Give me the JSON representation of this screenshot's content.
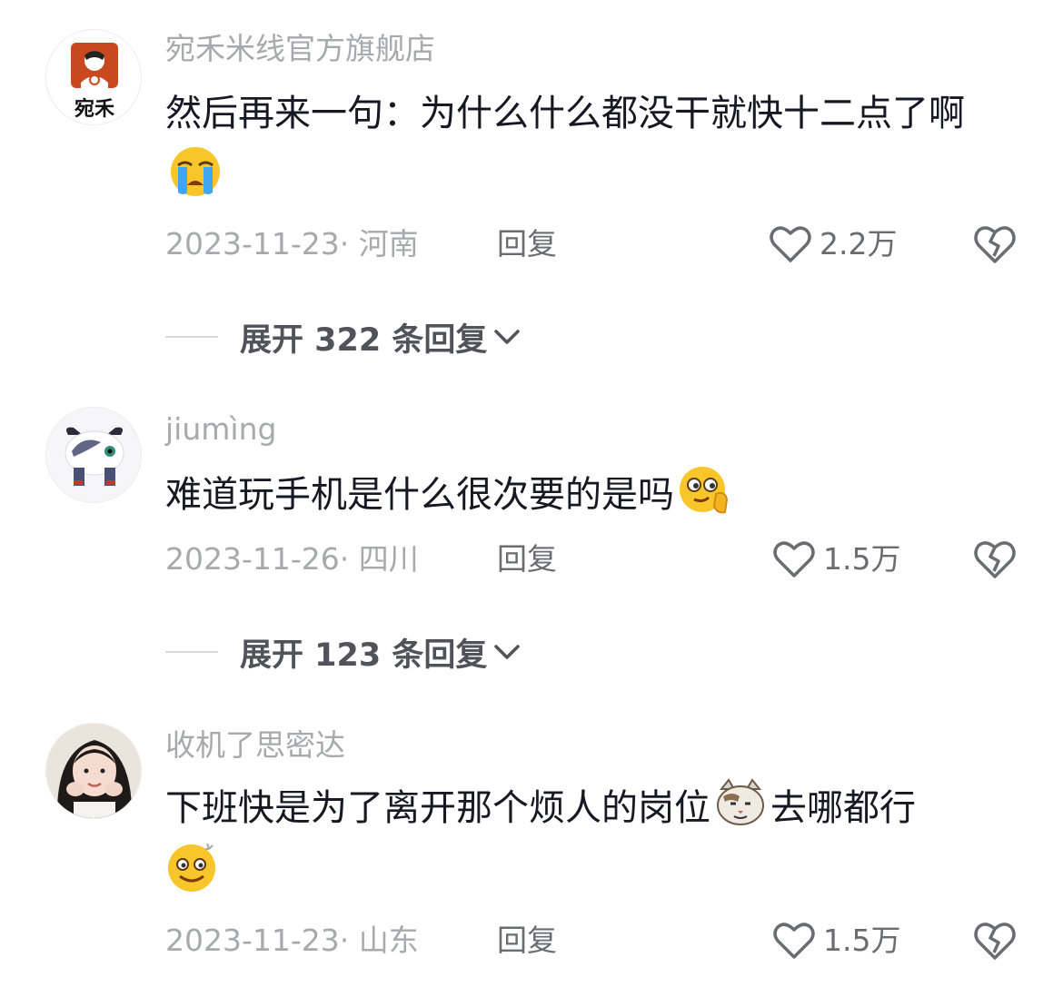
{
  "comments": [
    {
      "username": "宛禾米线官方旗舰店",
      "avatar_icon": "brand-logo-avatar",
      "text": "然后再来一句：为什么什么都没干就快十二点了啊",
      "emoji": "crying-face-emoji",
      "date_location": "2023-11-23· 河南",
      "reply_label": "回复",
      "likes": "2.2万",
      "expand_label": "展开 322 条回复"
    },
    {
      "username": "jiumìng",
      "avatar_icon": "anime-character-avatar",
      "text": "难道玩手机是什么很次要的是吗",
      "emoji": "thinking-face-emoji",
      "date_location": "2023-11-26· 四川",
      "reply_label": "回复",
      "likes": "1.5万",
      "expand_label": "展开 123 条回复"
    },
    {
      "username": "收机了思密达",
      "avatar_icon": "user-photo-avatar",
      "text_before": "下班快是为了离开那个烦人的岗位",
      "emoji_inline": "smug-cat-emoji",
      "text_after": "去哪都行",
      "emoji": "dizzy-smile-emoji",
      "date_location": "2023-11-23· 山东",
      "reply_label": "回复",
      "likes": "1.5万"
    }
  ],
  "icons": {
    "like": "heart-outline-icon",
    "dislike": "broken-heart-icon",
    "expand": "chevron-down-icon"
  },
  "colors": {
    "text_primary": "#161823",
    "text_secondary": "#a8a9ad",
    "text_action": "#6b6c71",
    "emoji_yellow": "#f8c62a"
  }
}
